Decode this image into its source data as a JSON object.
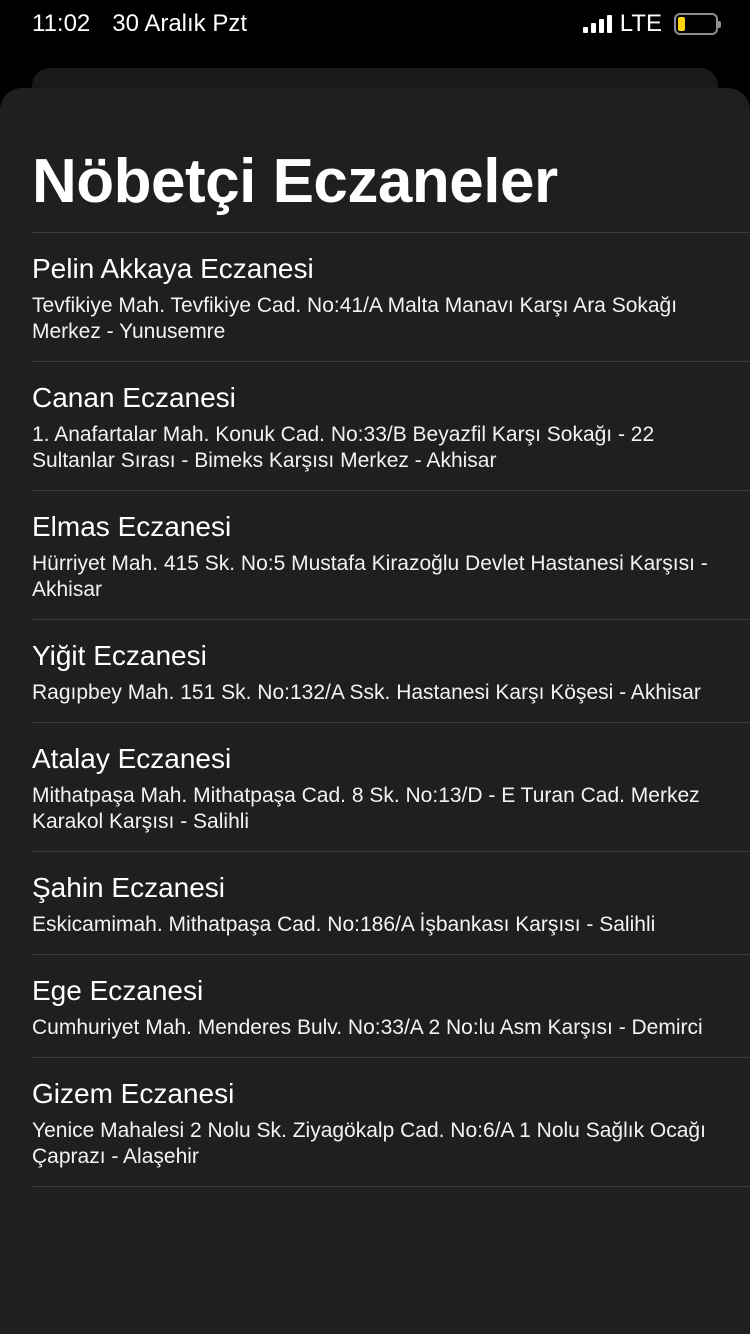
{
  "status_bar": {
    "time": "11:02",
    "date": "30 Aralık Pzt",
    "network": "LTE",
    "signal_bars": 4,
    "battery_level_fraction": 0.2,
    "battery_color": "#ffd60a"
  },
  "page": {
    "title": "Nöbetçi Eczaneler"
  },
  "pharmacies": [
    {
      "name": "Pelin Akkaya Eczanesi",
      "address": "Tevfikiye Mah. Tevfikiye Cad. No:41/A Malta Manavı Karşı Ara Sokağı Merkez - Yunusemre"
    },
    {
      "name": "Canan Eczanesi",
      "address": "1. Anafartalar Mah. Konuk Cad. No:33/B Beyazfil Karşı Sokağı - 22 Sultanlar Sırası - Bimeks Karşısı Merkez - Akhisar"
    },
    {
      "name": "Elmas Eczanesi",
      "address": "Hürriyet Mah. 415 Sk. No:5 Mustafa Kirazoğlu Devlet Hastanesi Karşısı - Akhisar"
    },
    {
      "name": "Yiğit Eczanesi",
      "address": "Ragıpbey Mah. 151 Sk. No:132/A Ssk. Hastanesi Karşı Köşesi - Akhisar"
    },
    {
      "name": "Atalay Eczanesi",
      "address": "Mithatpaşa Mah. Mithatpaşa Cad. 8 Sk. No:13/D - E Turan Cad. Merkez Karakol Karşısı - Salihli"
    },
    {
      "name": "Şahin Eczanesi",
      "address": "Eskicamimah. Mithatpaşa Cad. No:186/A İşbankası Karşısı - Salihli"
    },
    {
      "name": "Ege Eczanesi",
      "address": "Cumhuriyet Mah. Menderes Bulv. No:33/A 2 No:lu Asm Karşısı - Demirci"
    },
    {
      "name": "Gizem Eczanesi",
      "address": "Yenice Mahalesi 2 Nolu Sk. Ziyagökalp Cad. No:6/A 1 Nolu Sağlık Ocağı Çaprazı - Alaşehir"
    }
  ]
}
